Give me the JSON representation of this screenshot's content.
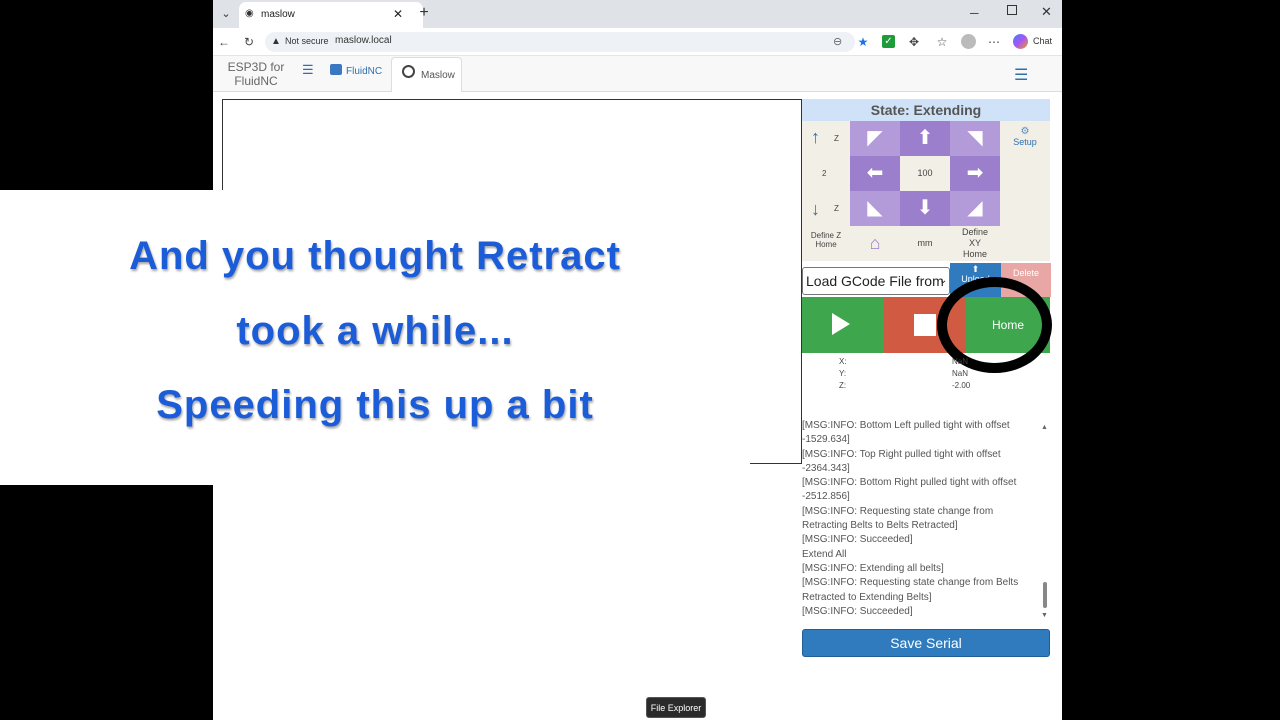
{
  "browser": {
    "tab_title": "maslow",
    "security_label": "Not secure",
    "url": "maslow.local",
    "chat_label": "Chat"
  },
  "app_nav": {
    "brand_line1": "ESP3D for",
    "brand_line2": "FluidNC",
    "tab_fluidnc": "FluidNC",
    "tab_maslow": "Maslow"
  },
  "panel": {
    "state": "State: Extending",
    "z_label": "Z",
    "step_value": "2",
    "setup_label": "Setup",
    "distance": "100",
    "define_z_home_line1": "Define Z",
    "define_z_home_line2": "Home",
    "unit": "mm",
    "define_xy_home_line1": "Define",
    "define_xy_home_line2": "XY",
    "define_xy_home_line3": "Home",
    "file_select": "Load GCode File from",
    "upload_label": "Upload",
    "delete_label": "Delete",
    "home_label": "Home",
    "coords": {
      "x_label": "X:",
      "y_label": "Y:",
      "z_label": "Z:",
      "x_value": "NaN",
      "y_value": "NaN",
      "z_value": "-2.00"
    },
    "log_lines": [
      "[MSG:INFO: Bottom Left pulled tight with offset",
      "-1529.634]",
      "[MSG:INFO: Top Right pulled tight with offset",
      "-2364.343]",
      "[MSG:INFO: Bottom Right pulled tight with offset",
      "-2512.856]",
      "[MSG:INFO: Requesting state change from",
      "Retracting Belts to Belts Retracted]",
      "[MSG:INFO: Succeeded]",
      "Extend All",
      "[MSG:INFO: Extending all belts]",
      "[MSG:INFO: Requesting state change from Belts",
      "Retracted to Extending Belts]",
      "[MSG:INFO: Succeeded]"
    ],
    "save_serial": "Save Serial"
  },
  "overlay": {
    "line1": "And you thought Retract",
    "line2": "took a while...",
    "line3": "Speeding this up a bit"
  },
  "tooltip": "File Explorer",
  "colors": {
    "jog_purple": "#b39ad8",
    "play_green": "#3ea64d",
    "stop_red": "#d05b42",
    "save_blue": "#2f7bbd",
    "overlay_blue": "#1b5cd8"
  }
}
